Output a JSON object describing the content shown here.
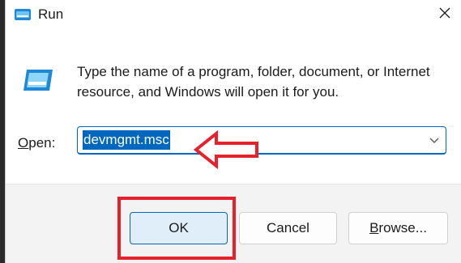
{
  "window": {
    "title": "Run",
    "title_icon": "run-icon",
    "close_icon": "close-icon"
  },
  "dialog": {
    "description": "Type the name of a program, folder, document, or Internet resource, and Windows will open it for you.",
    "open_label_prefix": "",
    "open_label_underlined": "O",
    "open_label_rest": "pen:",
    "open_value": "devmgmt.msc",
    "open_selected": true
  },
  "buttons": {
    "ok": "OK",
    "cancel": "Cancel",
    "browse_underlined": "B",
    "browse_rest": "rowse..."
  },
  "annotations": {
    "arrow_color": "#e8202c",
    "highlight_color": "#e8202c"
  },
  "colors": {
    "accent": "#0067c0",
    "footer_bg": "#f3f3f3",
    "ok_bg": "#e0eefa"
  }
}
